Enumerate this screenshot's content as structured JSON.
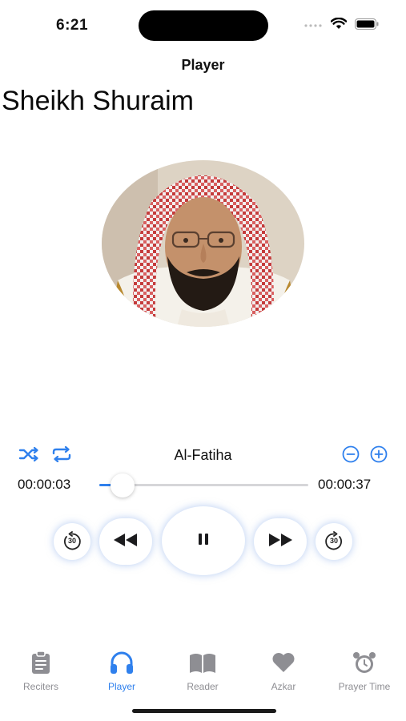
{
  "status": {
    "time": "6:21"
  },
  "header": {
    "title": "Player"
  },
  "reciter": {
    "name": "Sheikh Shuraim"
  },
  "player": {
    "track_title": "Al-Fatiha",
    "elapsed": "00:00:03",
    "duration": "00:00:37",
    "progress": 0.08,
    "skip_back_label": "30",
    "skip_forward_label": "30"
  },
  "tabs": [
    {
      "label": "Reciters",
      "icon": "clipboard-icon",
      "active": false
    },
    {
      "label": "Player",
      "icon": "headphones-icon",
      "active": true
    },
    {
      "label": "Reader",
      "icon": "book-icon",
      "active": false
    },
    {
      "label": "Azkar",
      "icon": "heart-icon",
      "active": false
    },
    {
      "label": "Prayer Time",
      "icon": "alarm-clock-icon",
      "active": false
    }
  ],
  "colors": {
    "accent": "#2f80ed",
    "inactive": "#8e8e93",
    "skin": "#c4916b",
    "scarf_red": "#c63a3a"
  }
}
